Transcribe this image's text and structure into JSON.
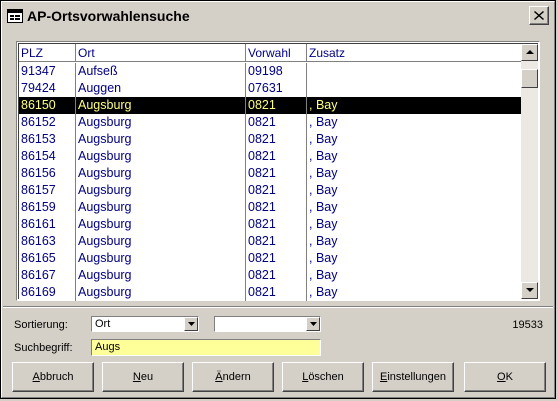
{
  "window": {
    "title": "AP-Ortsvorwahlensuche",
    "icon": "form-icon",
    "close_icon": "close-icon"
  },
  "grid": {
    "columns": [
      "PLZ",
      "Ort",
      "Vorwahl",
      "Zusatz"
    ],
    "rows": [
      {
        "plz": "91347",
        "ort": "Aufseß",
        "vorwahl": "09198",
        "zusatz": ""
      },
      {
        "plz": "79424",
        "ort": "Auggen",
        "vorwahl": "07631",
        "zusatz": ""
      },
      {
        "plz": "86150",
        "ort": "Augsburg",
        "vorwahl": "0821",
        "zusatz": ", Bay",
        "selected": true
      },
      {
        "plz": "86152",
        "ort": "Augsburg",
        "vorwahl": "0821",
        "zusatz": ", Bay"
      },
      {
        "plz": "86153",
        "ort": "Augsburg",
        "vorwahl": "0821",
        "zusatz": ", Bay"
      },
      {
        "plz": "86154",
        "ort": "Augsburg",
        "vorwahl": "0821",
        "zusatz": ", Bay"
      },
      {
        "plz": "86156",
        "ort": "Augsburg",
        "vorwahl": "0821",
        "zusatz": ", Bay"
      },
      {
        "plz": "86157",
        "ort": "Augsburg",
        "vorwahl": "0821",
        "zusatz": ", Bay"
      },
      {
        "plz": "86159",
        "ort": "Augsburg",
        "vorwahl": "0821",
        "zusatz": ", Bay"
      },
      {
        "plz": "86161",
        "ort": "Augsburg",
        "vorwahl": "0821",
        "zusatz": ", Bay"
      },
      {
        "plz": "86163",
        "ort": "Augsburg",
        "vorwahl": "0821",
        "zusatz": ", Bay"
      },
      {
        "plz": "86165",
        "ort": "Augsburg",
        "vorwahl": "0821",
        "zusatz": ", Bay"
      },
      {
        "plz": "86167",
        "ort": "Augsburg",
        "vorwahl": "0821",
        "zusatz": ", Bay"
      },
      {
        "plz": "86169",
        "ort": "Augsburg",
        "vorwahl": "0821",
        "zusatz": ", Bay"
      }
    ]
  },
  "form": {
    "sort_label": "Sortierung:",
    "sort_value": "Ort",
    "sort2_value": "",
    "search_label": "Suchbegriff:",
    "search_value": "Augs",
    "count": "19533"
  },
  "buttons": {
    "abbruch": {
      "u": "A",
      "rest": "bbruch"
    },
    "neu": {
      "u": "N",
      "rest": "eu"
    },
    "aendern": {
      "u": "Ä",
      "rest": "ndern"
    },
    "loeschen": {
      "u": "L",
      "rest": "öschen"
    },
    "einstellungen": {
      "u": "E",
      "rest": "instellungen"
    },
    "ok": {
      "u": "O",
      "rest": "K"
    }
  },
  "colors": {
    "face": "#d4d0c8",
    "text_blue": "#000080",
    "selection_bg": "#000000",
    "selection_text": "#ffff80",
    "search_bg": "#ffff99"
  }
}
